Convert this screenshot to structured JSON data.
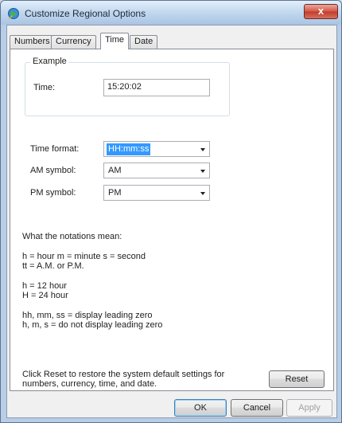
{
  "window": {
    "title": "Customize Regional Options",
    "close_glyph": "x"
  },
  "tabs": [
    {
      "label": "Numbers"
    },
    {
      "label": "Currency"
    },
    {
      "label": "Time"
    },
    {
      "label": "Date"
    }
  ],
  "active_tab": "Time",
  "example": {
    "legend": "Example",
    "time_label": "Time:",
    "time_value": "15:20:02"
  },
  "fields": {
    "time_format": {
      "label": "Time format:",
      "value": "HH:mm:ss"
    },
    "am_symbol": {
      "label": "AM symbol:",
      "value": "AM"
    },
    "pm_symbol": {
      "label": "PM symbol:",
      "value": "PM"
    }
  },
  "notations": {
    "heading": "What the notations mean:",
    "line1": "h = hour   m = minute   s = second",
    "line2": "tt = A.M. or P.M.",
    "line3": "h = 12 hour",
    "line4": "H = 24 hour",
    "line5": "hh, mm, ss = display leading zero",
    "line6": "h, m, s = do not display leading zero"
  },
  "reset": {
    "text_line1": "Click Reset to restore the system default settings for",
    "text_line2": "numbers, currency, time, and date.",
    "button": "Reset"
  },
  "buttons": {
    "ok": "OK",
    "cancel": "Cancel",
    "apply": "Apply"
  },
  "colors": {
    "selection": "#3399ff",
    "close_button": "#c23b2a"
  }
}
